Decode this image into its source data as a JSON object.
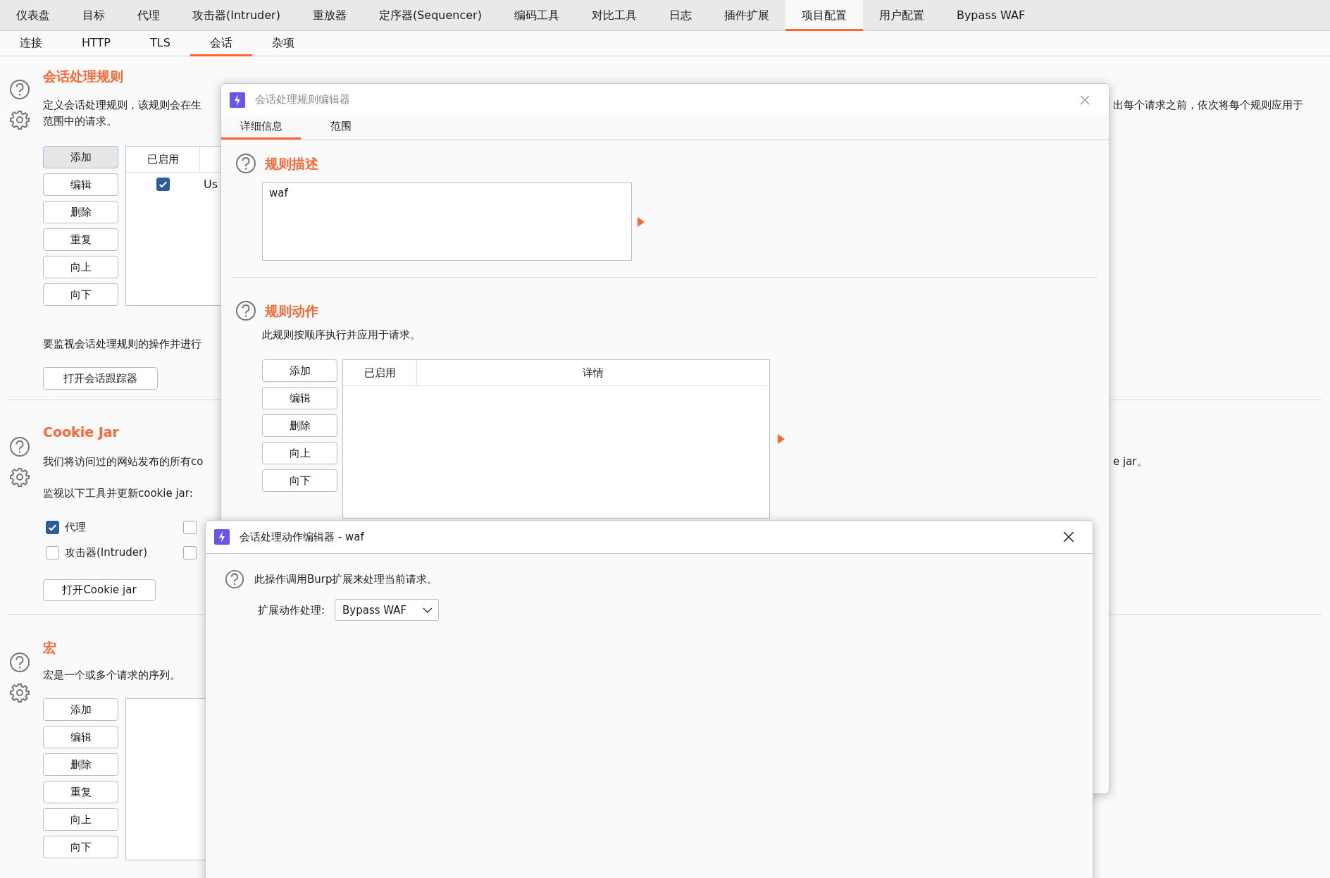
{
  "main_tabs": [
    {
      "label": "仪表盘",
      "selected": false
    },
    {
      "label": "目标",
      "selected": false
    },
    {
      "label": "代理",
      "selected": false
    },
    {
      "label": "攻击器(Intruder)",
      "selected": false
    },
    {
      "label": "重放器",
      "selected": false
    },
    {
      "label": "定序器(Sequencer)",
      "selected": false
    },
    {
      "label": "编码工具",
      "selected": false
    },
    {
      "label": "对比工具",
      "selected": false
    },
    {
      "label": "日志",
      "selected": false
    },
    {
      "label": "插件扩展",
      "selected": false
    },
    {
      "label": "项目配置",
      "selected": true
    },
    {
      "label": "用户配置",
      "selected": false
    },
    {
      "label": "Bypass WAF",
      "selected": false
    }
  ],
  "sub_tabs": [
    {
      "label": "连接",
      "selected": false
    },
    {
      "label": "HTTP",
      "selected": false
    },
    {
      "label": "TLS",
      "selected": false
    },
    {
      "label": "会话",
      "selected": true
    },
    {
      "label": "杂项",
      "selected": false
    }
  ],
  "session_rules": {
    "title": "会话处理规则",
    "description_left": "定义会话处理规则，该规则会在生",
    "description_right": "出每个请求之前，依次将每个规则应用于",
    "description_line2": "范围中的请求。",
    "buttons": [
      {
        "label": "添加",
        "focused": true
      },
      {
        "label": "编辑",
        "focused": false
      },
      {
        "label": "删除",
        "focused": false
      },
      {
        "label": "重复",
        "focused": false
      },
      {
        "label": "向上",
        "focused": false
      },
      {
        "label": "向下",
        "focused": false
      }
    ],
    "table": {
      "columns": [
        "已启用"
      ],
      "rows": [
        {
          "enabled": true,
          "column_2": "Us"
        }
      ]
    },
    "tracker_text": "要监视会话处理规则的操作并进行",
    "tracker_button": "打开会话跟踪器"
  },
  "cookie_jar": {
    "title": "Cookie Jar",
    "description_left": "我们将访问过的网站发布的所有co",
    "description_right": "e jar。",
    "monitor_label": "监视以下工具并更新cookie jar:",
    "tools": [
      {
        "label": "代理",
        "checked": true
      },
      {
        "checked": false
      },
      {
        "label": "攻击器(Intruder)",
        "checked": false
      },
      {
        "checked": false
      }
    ],
    "open_button": "打开Cookie jar"
  },
  "macros": {
    "title": "宏",
    "description": "宏是一个或多个请求的序列。",
    "buttons": [
      "添加",
      "编辑",
      "删除",
      "重复",
      "向上",
      "向下"
    ]
  },
  "rule_editor": {
    "title": "会话处理规则编辑器",
    "tabs": [
      {
        "label": "详细信息",
        "selected": true
      },
      {
        "label": "范围",
        "selected": false
      }
    ],
    "description_title": "规则描述",
    "description_value": "waf",
    "actions_title": "规则动作",
    "actions_text": "此规则按顺序执行并应用于请求。",
    "buttons": [
      "添加",
      "编辑",
      "删除",
      "向上",
      "向下"
    ],
    "table_columns": [
      "已启用",
      "详情"
    ]
  },
  "action_editor": {
    "title": "会话处理动作编辑器 - waf",
    "text": "此操作调用Burp扩展来处理当前请求。",
    "handler_label": "扩展动作处理:",
    "handler_value": "Bypass WAF"
  }
}
